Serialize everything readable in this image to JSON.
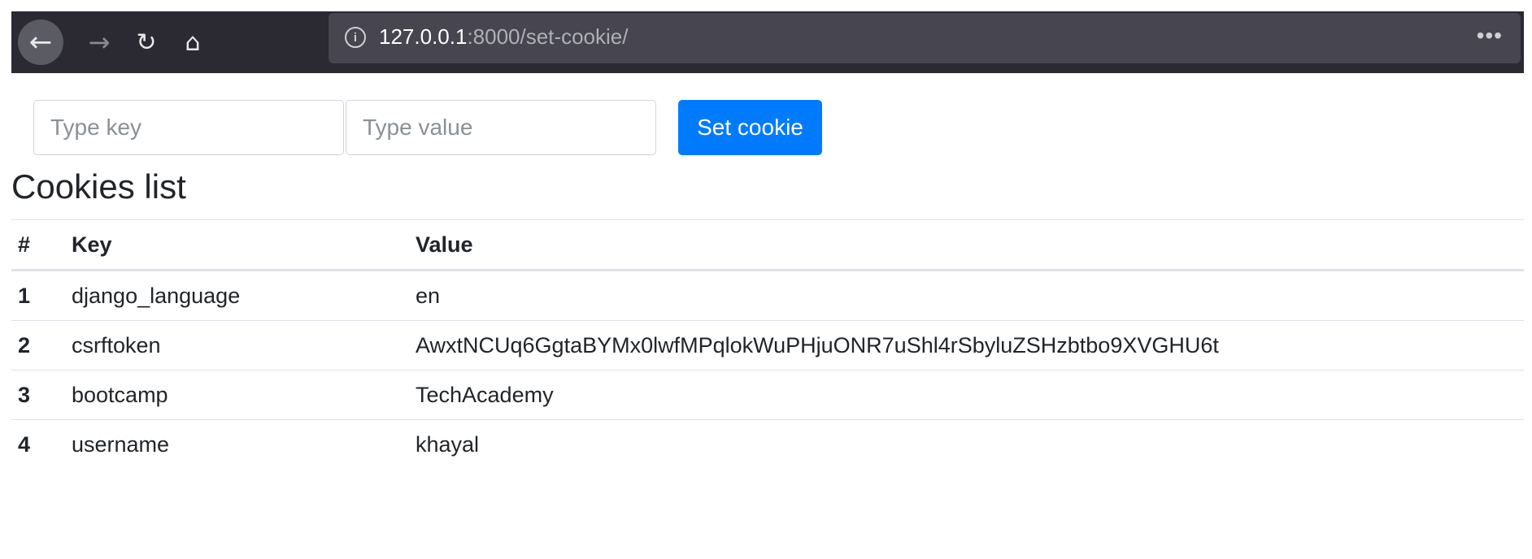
{
  "browser": {
    "url_host": "127.0.0.1",
    "url_rest": ":8000/set-cookie/",
    "back_glyph": "←",
    "forward_glyph": "→",
    "reload_glyph": "↻",
    "home_glyph": "⌂",
    "info_glyph": "i",
    "menu_glyph": "•••"
  },
  "form": {
    "key_placeholder": "Type key",
    "value_placeholder": "Type value",
    "submit_label": "Set cookie",
    "accent_color": "#007bff"
  },
  "page_title": "Cookies list",
  "table": {
    "headers": [
      "#",
      "Key",
      "Value"
    ],
    "rows": [
      {
        "num": "1",
        "key": "django_language",
        "value": "en"
      },
      {
        "num": "2",
        "key": "csrftoken",
        "value": "AwxtNCUq6GgtaBYMx0lwfMPqlokWuPHjuONR7uShl4rSbyluZSHzbtbo9XVGHU6t"
      },
      {
        "num": "3",
        "key": "bootcamp",
        "value": "TechAcademy"
      },
      {
        "num": "4",
        "key": "username",
        "value": "khayal"
      }
    ]
  }
}
